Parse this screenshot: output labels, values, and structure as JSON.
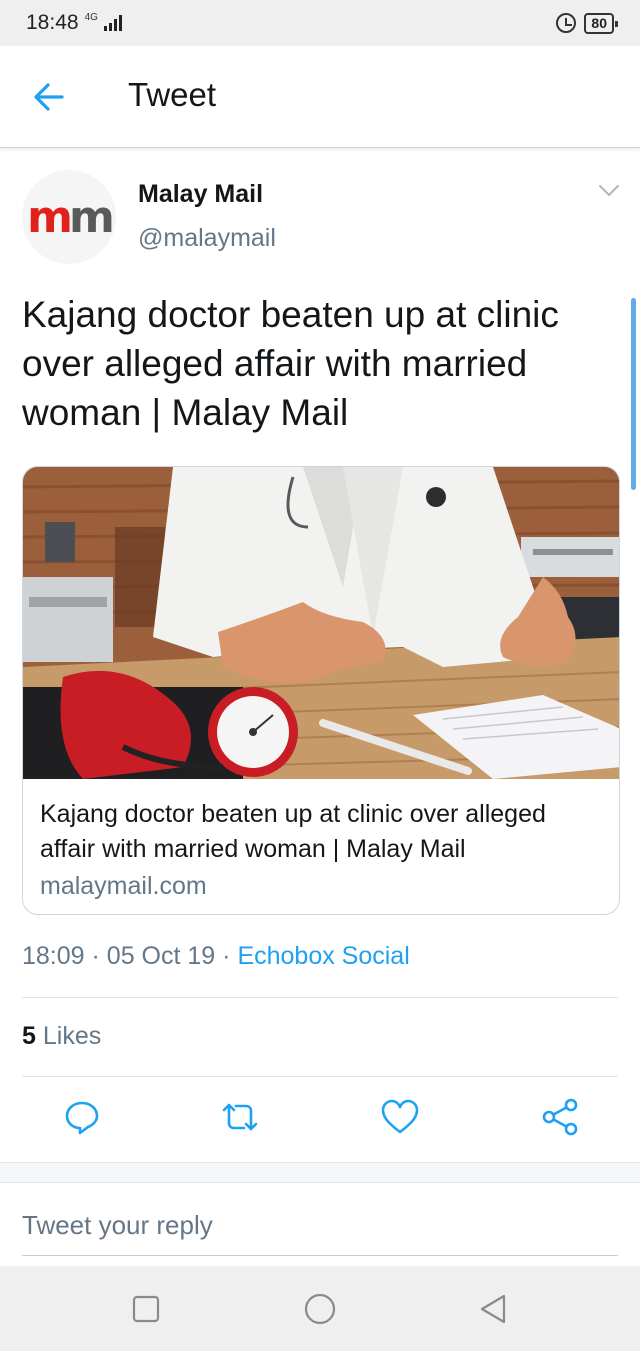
{
  "status_bar": {
    "time": "18:48",
    "network": "4G",
    "battery": "80"
  },
  "header": {
    "title": "Tweet"
  },
  "tweet": {
    "author_name": "Malay Mail",
    "author_handle": "@malaymail",
    "avatar_logo": "mm",
    "text": "Kajang doctor beaten up at clinic over alleged affair with married woman | Malay Mail",
    "card": {
      "title": "Kajang doctor beaten up at clinic over alleged affair with married woman | Malay Mail",
      "domain": "malaymail.com"
    },
    "time": "18:09",
    "date": "05 Oct 19",
    "source": "Echobox Social",
    "likes_count": "5",
    "likes_label": "Likes"
  },
  "reply": {
    "placeholder": "Tweet your reply"
  },
  "colors": {
    "accent": "#1da1f2",
    "secondary_text": "#657786",
    "logo_red": "#e2211c"
  },
  "icons": {
    "back": "arrow-left-icon",
    "caret": "chevron-down-icon",
    "reply": "comment-icon",
    "retweet": "retweet-icon",
    "like": "heart-icon",
    "share": "share-icon"
  }
}
